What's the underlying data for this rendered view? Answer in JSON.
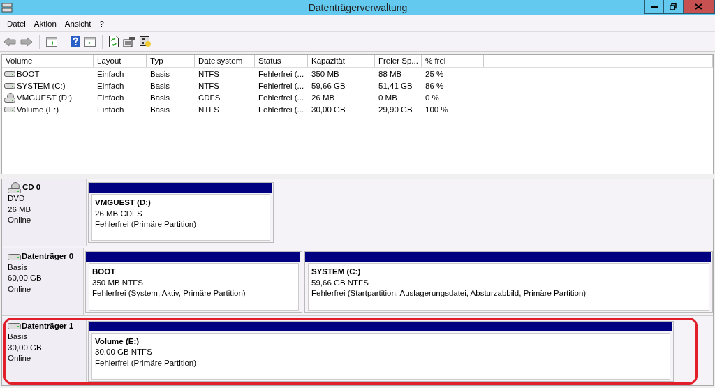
{
  "window": {
    "title": "Datenträgerverwaltung"
  },
  "menu": [
    "Datei",
    "Aktion",
    "Ansicht",
    "?"
  ],
  "volume_list": {
    "columns": [
      "Volume",
      "Layout",
      "Typ",
      "Dateisystem",
      "Status",
      "Kapazität",
      "Freier Sp...",
      "% frei"
    ],
    "rows": [
      {
        "kind": "disk",
        "cells": [
          "BOOT",
          "Einfach",
          "Basis",
          "NTFS",
          "Fehlerfrei (...",
          "350 MB",
          "88 MB",
          "25 %"
        ]
      },
      {
        "kind": "disk",
        "cells": [
          "SYSTEM (C:)",
          "Einfach",
          "Basis",
          "NTFS",
          "Fehlerfrei (...",
          "59,66 GB",
          "51,41 GB",
          "86 %"
        ]
      },
      {
        "kind": "cd",
        "cells": [
          "VMGUEST (D:)",
          "Einfach",
          "Basis",
          "CDFS",
          "Fehlerfrei (...",
          "26 MB",
          "0 MB",
          "0 %"
        ]
      },
      {
        "kind": "disk",
        "cells": [
          "Volume (E:)",
          "Einfach",
          "Basis",
          "NTFS",
          "Fehlerfrei (...",
          "30,00 GB",
          "29,90 GB",
          "100 %"
        ]
      }
    ]
  },
  "disks": [
    {
      "kind": "cd",
      "name": "CD 0",
      "type": "DVD",
      "size": "26 MB",
      "state": "Online",
      "highlighted": false,
      "partitions": [
        {
          "name": "VMGUEST  (D:)",
          "size": "26 MB CDFS",
          "status": "Fehlerfrei (Primäre Partition)"
        }
      ]
    },
    {
      "kind": "disk",
      "name": "Datenträger 0",
      "type": "Basis",
      "size": "60,00 GB",
      "state": "Online",
      "highlighted": false,
      "partitions": [
        {
          "name": "BOOT",
          "size": "350 MB NTFS",
          "status": "Fehlerfrei (System, Aktiv, Primäre Partition)"
        },
        {
          "name": "SYSTEM  (C:)",
          "size": "59,66 GB NTFS",
          "status": "Fehlerfrei (Startpartition, Auslagerungsdatei, Absturzabbild, Primäre Partition)"
        }
      ]
    },
    {
      "kind": "disk",
      "name": "Datenträger 1",
      "type": "Basis",
      "size": "30,00 GB",
      "state": "Online",
      "highlighted": true,
      "partitions": [
        {
          "name": "Volume  (E:)",
          "size": "30,00 GB NTFS",
          "status": "Fehlerfrei (Primäre Partition)"
        }
      ]
    }
  ]
}
